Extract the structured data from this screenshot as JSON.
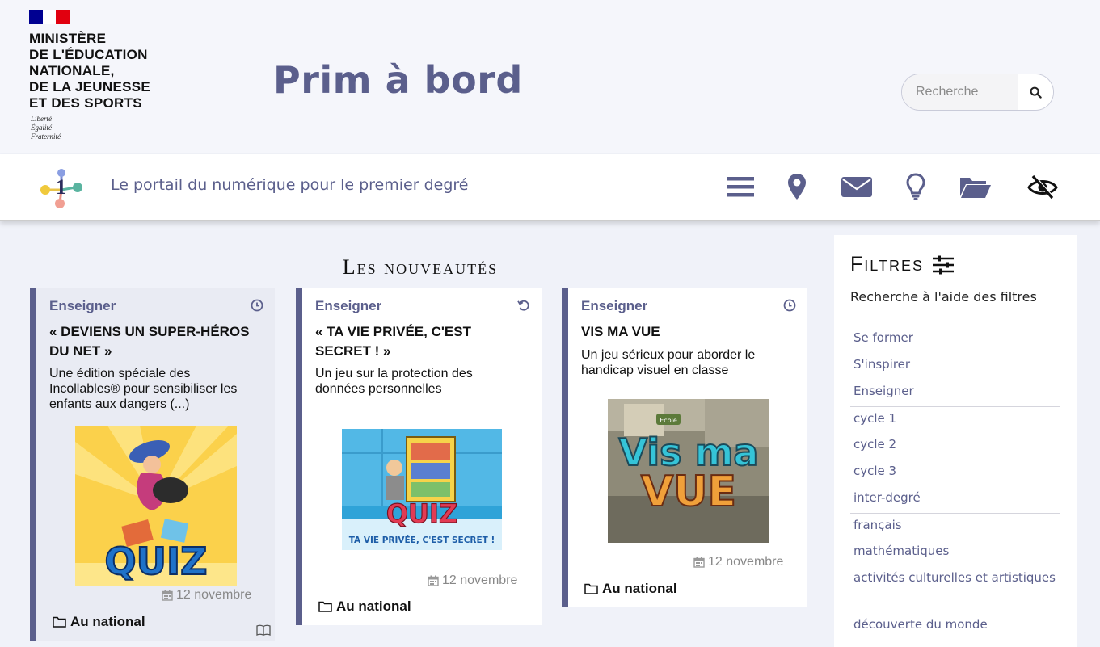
{
  "header": {
    "ministry_lines": [
      "MINISTÈRE",
      "DE L'ÉDUCATION",
      "NATIONALE,",
      "DE LA JEUNESSE",
      "ET DES SPORTS"
    ],
    "motto_lines": [
      "Liberté",
      "Égalité",
      "Fraternité"
    ],
    "site_title": "Prim à bord",
    "search_placeholder": "Recherche",
    "flag_colors": [
      "#000091",
      "#ffffff",
      "#e1000f"
    ]
  },
  "navbar": {
    "tagline": "Le portail du numérique pour le premier degré",
    "icons": [
      "menu-icon",
      "map-pin-icon",
      "envelope-icon",
      "lightbulb-icon",
      "folder-open-icon",
      "eye-slash-icon"
    ]
  },
  "section_title": "Les nouveautés",
  "cards": [
    {
      "category": "Enseigner",
      "status_icon": "clock-icon",
      "title_lines": [
        "« DEVIENS UN SUPER-HÉROS",
        "DU NET »"
      ],
      "description_lines": [
        "Une édition spéciale des",
        "Incollables® pour sensibiliser les",
        "enfants aux dangers (...)"
      ],
      "image_text": "QUIZ",
      "date": "12 novembre",
      "location": "Au national",
      "footer_icon": "book-icon"
    },
    {
      "category": "Enseigner",
      "status_icon": "refresh-icon",
      "title_lines": [
        "« TA VIE PRIVÉE, C'EST",
        "SECRET ! »"
      ],
      "description_lines": [
        "Un jeu sur la protection des",
        "données personnelles"
      ],
      "image_text": "QUIZ",
      "image_caption": "TA VIE PRIVÉE, C'EST SECRET !",
      "date": "12 novembre",
      "location": "Au national"
    },
    {
      "category": "Enseigner",
      "status_icon": "clock-icon",
      "title_lines": [
        "VIS MA VUE"
      ],
      "description_lines": [
        "Un jeu sérieux pour aborder le",
        "handicap visuel en classe"
      ],
      "image_text_top": "Vis ma",
      "image_text_bottom": "VUE",
      "image_sign": "Ecole",
      "date": "12 novembre",
      "location": "Au national"
    }
  ],
  "filters": {
    "title": "Filtres",
    "subtitle": "Recherche à l'aide des filtres",
    "items": [
      "Se former",
      "S'inspirer",
      "Enseigner",
      "cycle 1",
      "cycle 2",
      "cycle 3",
      "inter-degré",
      "français",
      "mathématiques",
      "activités culturelles et artistiques",
      "découverte du monde"
    ]
  },
  "colors": {
    "accent": "#5b5f8c",
    "page_bg": "#f0f2f9",
    "card_grey": "#e9ebf3"
  }
}
